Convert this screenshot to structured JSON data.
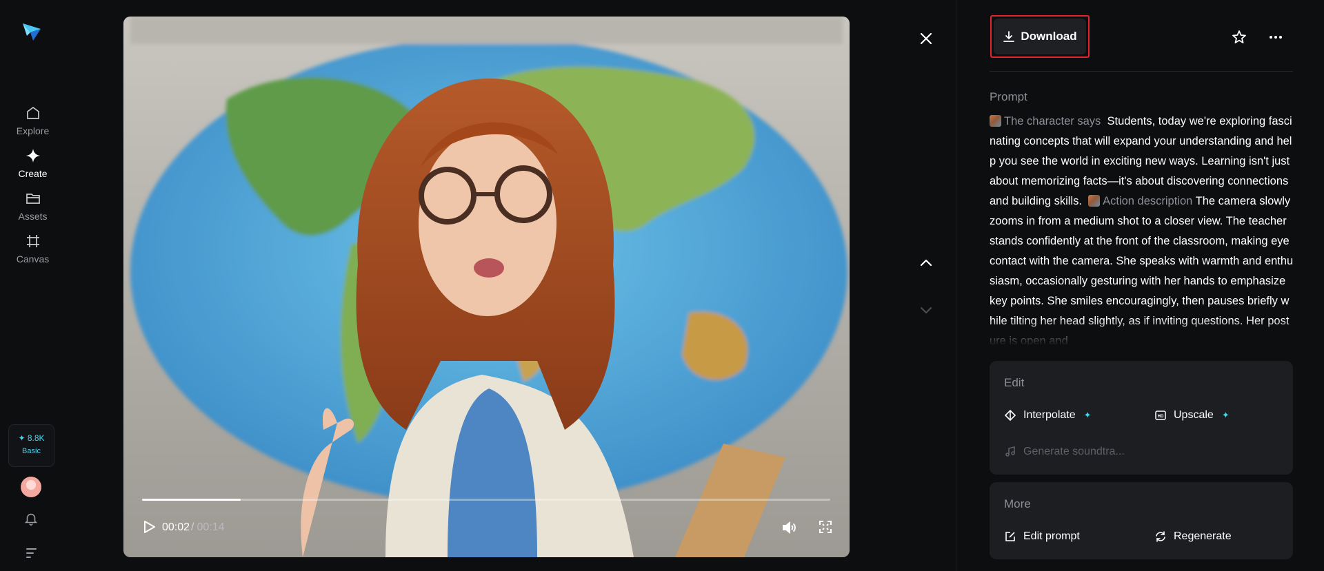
{
  "sidebar": {
    "items": [
      {
        "label": "Explore",
        "icon": "home-icon"
      },
      {
        "label": "Create",
        "icon": "diamond-icon"
      },
      {
        "label": "Assets",
        "icon": "folder-icon"
      },
      {
        "label": "Canvas",
        "icon": "canvas-icon"
      }
    ],
    "credits": {
      "amount": "✦ 8.8K",
      "plan": "Basic"
    }
  },
  "player": {
    "current_time": "00:02",
    "separator": "/",
    "duration": "00:14",
    "progress_fraction": 0.143
  },
  "panel": {
    "download_label": "Download",
    "prompt_label": "Prompt",
    "prompt": {
      "chip1": "The character says",
      "text1": "Students, today we're exploring fascinating concepts that will expand your understanding and help you see the world in exciting new ways. Learning isn't just about memorizing facts—it's about discovering connections and building skills.",
      "chip2": "Action description",
      "text2": "The camera slowly zooms in from a medium shot to a closer view. The teacher stands confidently at the front of the classroom, making eye contact with the camera. She speaks with warmth and enthusiasm, occasionally gesturing with her hands to emphasize key points. She smiles encouragingly, then pauses briefly while tilting her head slightly, as if inviting questions. Her posture is open and"
    },
    "edit": {
      "title": "Edit",
      "interpolate": "Interpolate",
      "upscale": "Upscale",
      "soundtrack": "Generate soundtra..."
    },
    "more": {
      "title": "More",
      "edit_prompt": "Edit prompt",
      "regenerate": "Regenerate"
    }
  },
  "colors": {
    "accent": "#3fd6f0",
    "highlight_border": "#e5242d",
    "background": "#0d0e10",
    "card": "#1c1e22"
  }
}
